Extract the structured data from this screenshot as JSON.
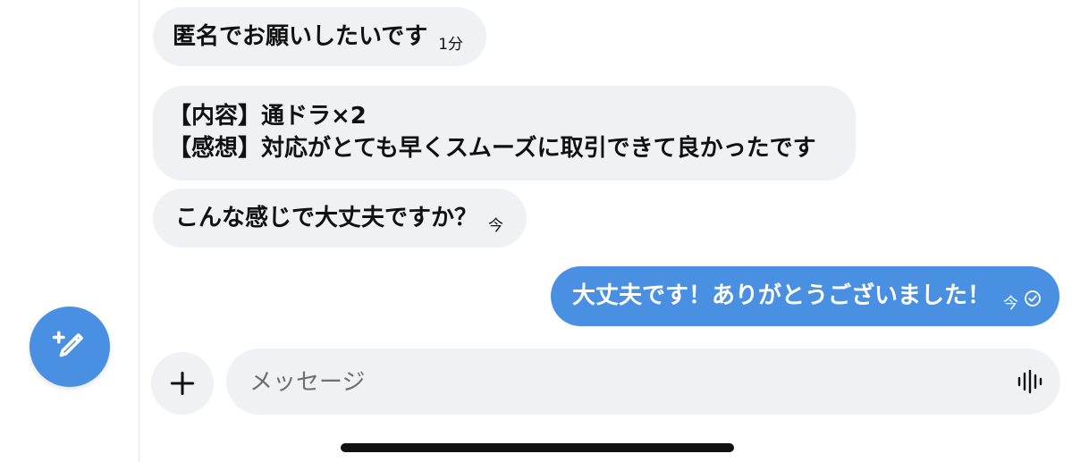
{
  "messages": [
    {
      "direction": "incoming",
      "text": "匿名でお願いしたいです",
      "time": "1分"
    },
    {
      "direction": "incoming",
      "lines": [
        "【内容】通ドラ×2",
        "【感想】対応がとても早くスムーズに取引できて良かったです"
      ]
    },
    {
      "direction": "incoming",
      "text": "こんな感じで大丈夫ですか？",
      "time": "今"
    },
    {
      "direction": "outgoing",
      "text": "大丈夫です！ありがとうございました！",
      "time": "今",
      "read": true
    }
  ],
  "composer": {
    "placeholder": "メッセージ",
    "add_icon": "plus-icon",
    "voice_icon": "voice-waveform-icon"
  },
  "fab": {
    "icon": "compose-icon"
  },
  "colors": {
    "accent": "#4a90e2",
    "bubble_incoming": "#eff1f3",
    "bubble_outgoing": "#4a90e2"
  }
}
